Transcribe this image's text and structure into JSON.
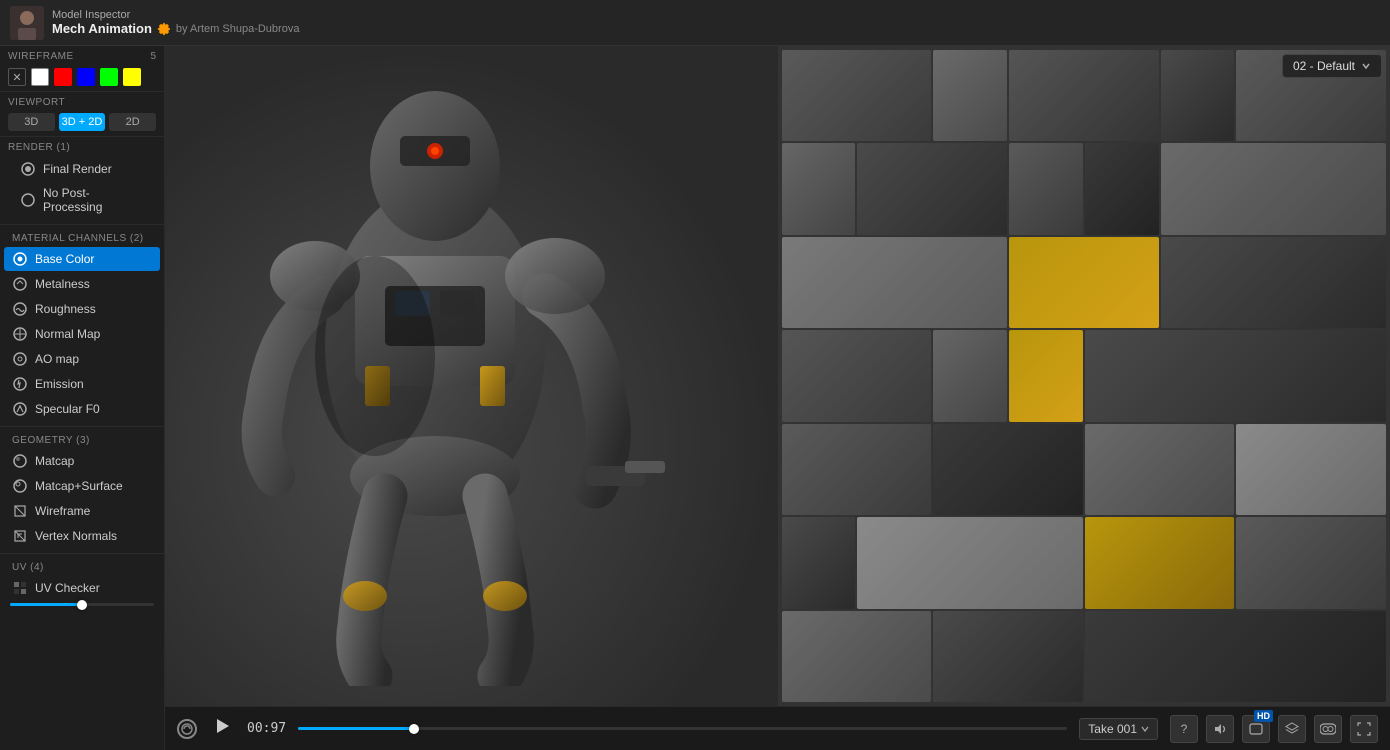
{
  "app": {
    "name": "Model Inspector",
    "project_name": "Mech Animation",
    "author": "by Artem Shupa-Dubrova"
  },
  "header": {
    "view_selector_label": "02 - Default"
  },
  "sidebar": {
    "wireframe": {
      "title": "WIREFRAME",
      "count": "5"
    },
    "viewport": {
      "title": "VIEWPORT",
      "buttons": [
        "3D",
        "3D + 2D",
        "2D"
      ],
      "active": "3D + 2D"
    },
    "render": {
      "title": "RENDER (1)",
      "items": [
        {
          "label": "Final Render",
          "icon": "circle-icon"
        },
        {
          "label": "No Post-Processing",
          "icon": "circle-icon"
        }
      ]
    },
    "material_channels": {
      "title": "MATERIAL CHANNELS (2)",
      "items": [
        {
          "label": "Base Color",
          "active": true
        },
        {
          "label": "Metalness"
        },
        {
          "label": "Roughness"
        },
        {
          "label": "Normal Map"
        },
        {
          "label": "AO map"
        },
        {
          "label": "Emission"
        },
        {
          "label": "Specular F0"
        }
      ]
    },
    "geometry": {
      "title": "GEOMETRY (3)",
      "items": [
        {
          "label": "Matcap"
        },
        {
          "label": "Matcap+Surface"
        },
        {
          "label": "Wireframe"
        },
        {
          "label": "Vertex Normals"
        }
      ]
    },
    "uv": {
      "title": "UV (4)",
      "items": [
        {
          "label": "UV Checker"
        }
      ]
    }
  },
  "swatches": {
    "colors": [
      "#fff",
      "#f00",
      "#00f",
      "#0f0",
      "#ff0"
    ]
  },
  "bottom_bar": {
    "timecode": "00:97",
    "take_label": "Take 001",
    "buttons": {
      "question": "?",
      "volume": "♪",
      "hd": "HD",
      "layers": "⊞",
      "vr": "👓",
      "fullscreen": "⛶"
    }
  },
  "progress": {
    "fill_percent": 15
  }
}
